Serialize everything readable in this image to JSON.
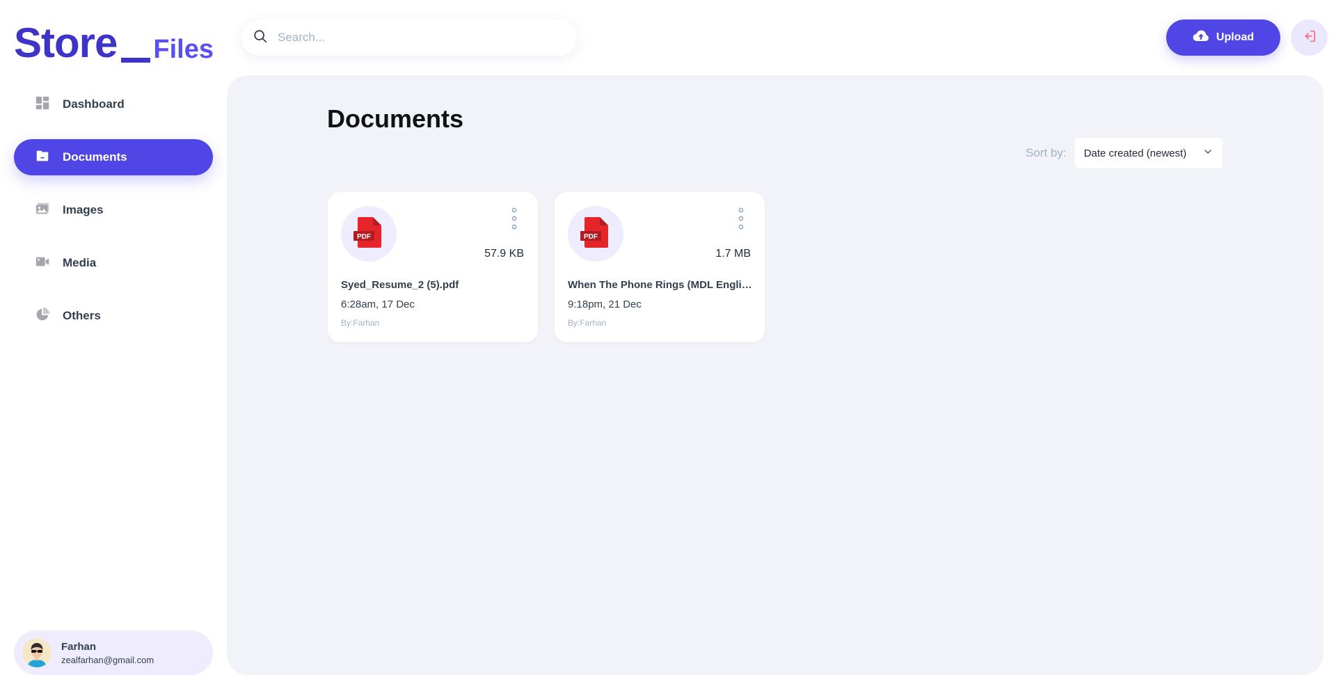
{
  "brand": {
    "main": "Store",
    "sub": "Files",
    "color": "#3f34c8"
  },
  "search": {
    "placeholder": "Search...",
    "value": ""
  },
  "header": {
    "upload_label": "Upload",
    "upload_icon": "cloud-upload-icon",
    "logout_icon": "logout-icon"
  },
  "sidebar": {
    "items": [
      {
        "label": "Dashboard",
        "icon": "dashboard-icon",
        "active": false
      },
      {
        "label": "Documents",
        "icon": "document-icon",
        "active": true
      },
      {
        "label": "Images",
        "icon": "image-icon",
        "active": false
      },
      {
        "label": "Media",
        "icon": "video-icon",
        "active": false
      },
      {
        "label": "Others",
        "icon": "pie-chart-icon",
        "active": false
      }
    ]
  },
  "user": {
    "name": "Farhan",
    "email": "zealfarhan@gmail.com"
  },
  "main": {
    "title": "Documents",
    "sort_label": "Sort by:",
    "sort_value": "Date created (newest)",
    "files": [
      {
        "name": "Syed_Resume_2 (5).pdf",
        "size": "57.9 KB",
        "date": "6:28am, 17 Dec",
        "owner": "By:Farhan",
        "type_label": "PDF"
      },
      {
        "name": "When The Phone Rings (MDL English).pdf",
        "size": "1.7 MB",
        "date": "9:18pm, 21 Dec",
        "owner": "By:Farhan",
        "type_label": "PDF"
      }
    ]
  },
  "colors": {
    "accent": "#5046e5",
    "main_bg": "#f2f3f8",
    "muted": "#a3b2c7",
    "pdf_red": "#e5252a"
  }
}
